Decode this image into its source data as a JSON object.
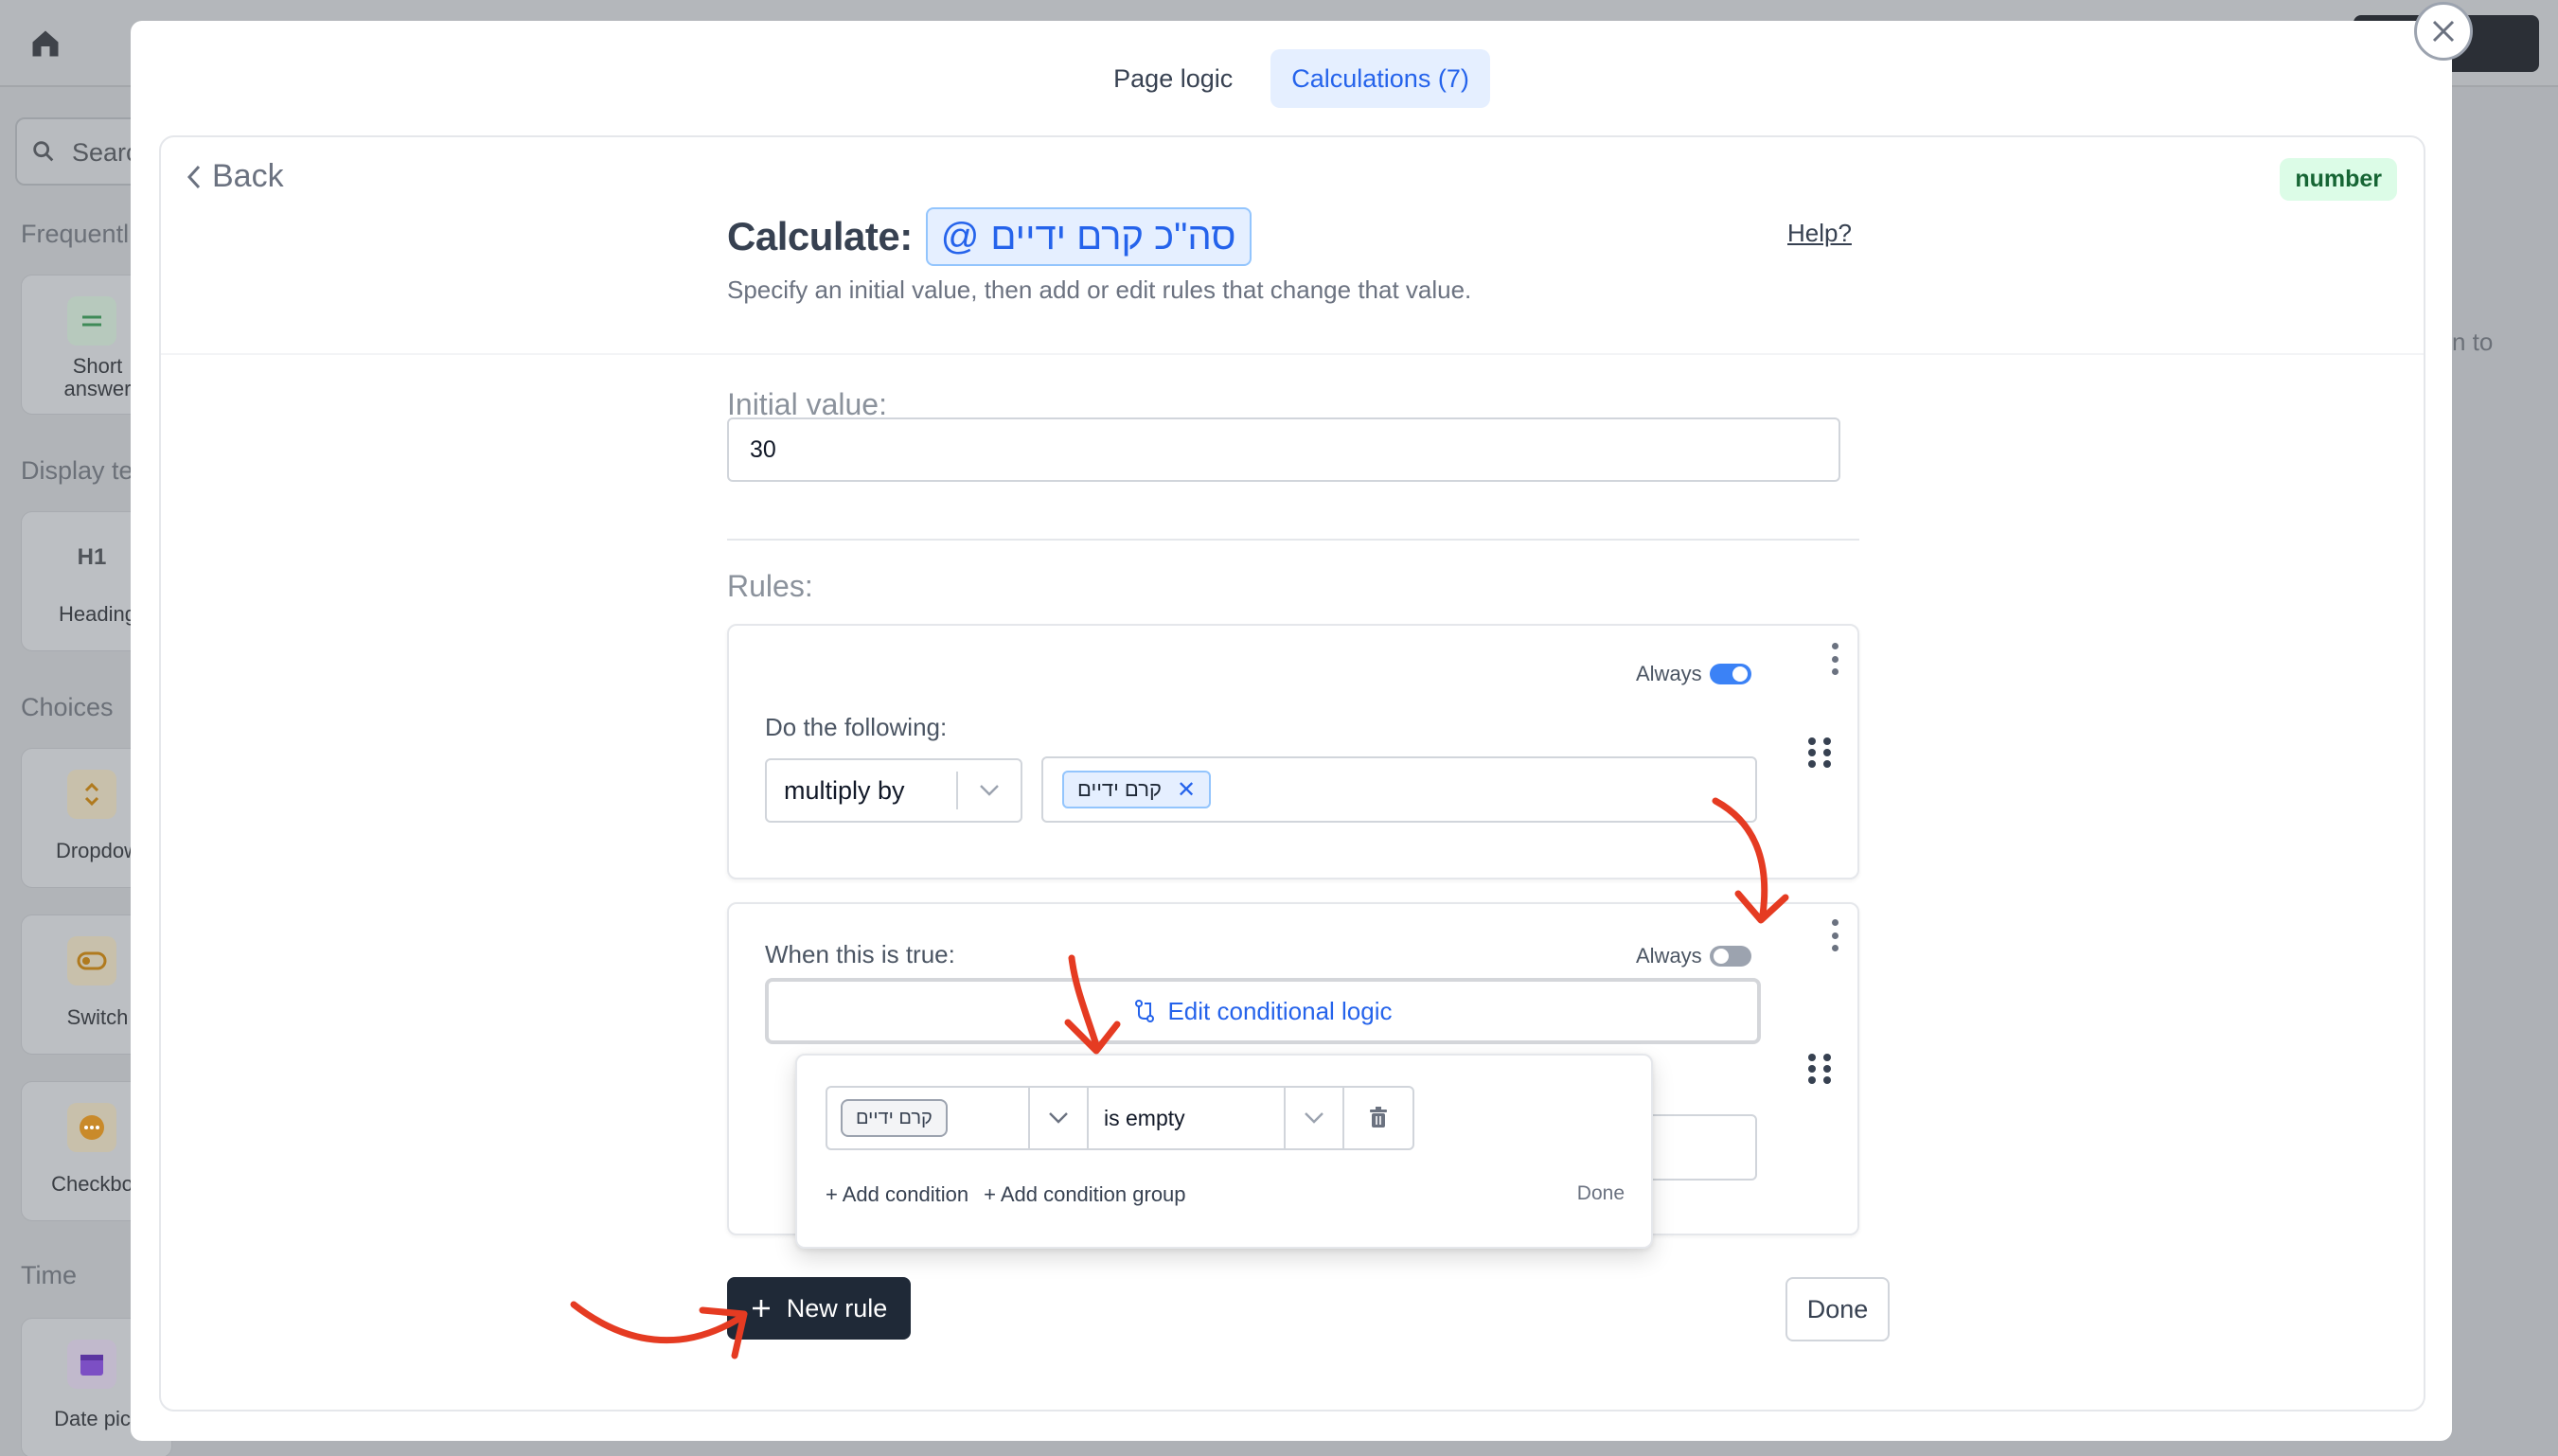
{
  "background": {
    "search_placeholder": "Searc",
    "sections": [
      "Frequentl",
      "Display te",
      "Choices",
      "Time"
    ],
    "cards": [
      {
        "label": "Short\nanswer",
        "icon": "short-answer-icon"
      },
      {
        "label": "Heading",
        "icon": "heading-icon"
      },
      {
        "label": "Dropdow",
        "icon": "dropdown-icon"
      },
      {
        "label": "Switch",
        "icon": "switch-icon"
      },
      {
        "label": "Checkbox",
        "icon": "checkbox-icon"
      },
      {
        "label": "Date pick",
        "icon": "calendar-icon"
      }
    ],
    "heading_icon_text": "H1",
    "right_text": "n to"
  },
  "tabs": [
    {
      "label": "Page logic",
      "active": false
    },
    {
      "label": "Calculations (7)",
      "active": true
    }
  ],
  "editor": {
    "back_label": "Back",
    "type_badge": "number",
    "title": "Calculate:",
    "variable_name": "סה\"כ קרם ידיים",
    "variable_at": "@",
    "help_label": "Help?",
    "subtitle": "Specify an initial value, then add or edit rules that change that value.",
    "initial_label": "Initial value:",
    "initial_value": "30",
    "rules_label": "Rules:"
  },
  "rules": [
    {
      "always_label": "Always",
      "always_on": true,
      "action_label": "Do the following:",
      "operation": "multiply by",
      "operand_chip": "קרם ידיים"
    },
    {
      "always_label": "Always",
      "always_on": false,
      "condition_label": "When this is true:",
      "edit_logic_label": "Edit conditional logic"
    }
  ],
  "condition_popover": {
    "field_chip": "קרם ידיים",
    "operator": "is empty",
    "add_condition": "+ Add condition",
    "add_group": "+ Add condition group",
    "done": "Done"
  },
  "footer": {
    "new_rule": "New rule",
    "done": "Done"
  },
  "colors": {
    "accent": "#2563eb",
    "annotation": "#e53b22",
    "primary_button": "#1f2937",
    "type_badge_bg": "#dcfce7"
  }
}
